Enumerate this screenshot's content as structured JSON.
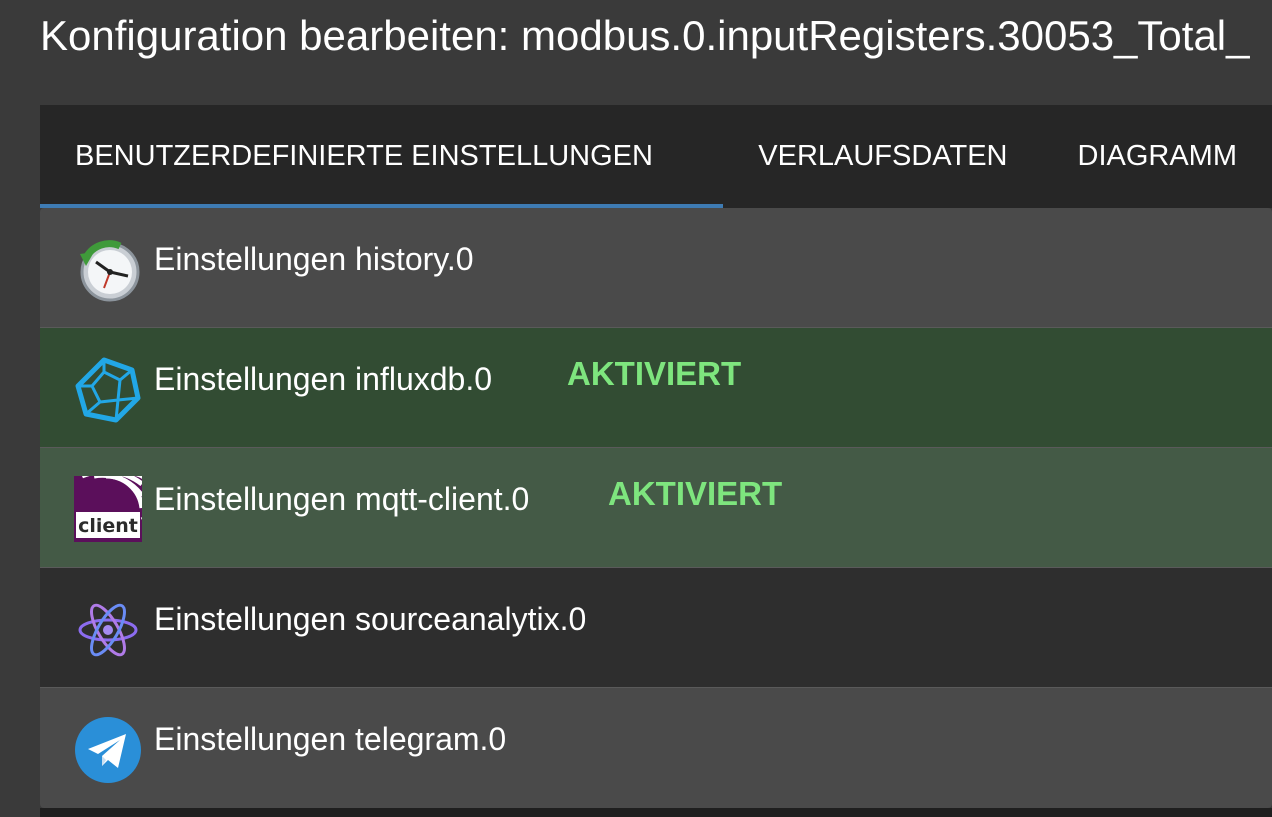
{
  "header": {
    "title": "Konfiguration bearbeiten: modbus.0.inputRegisters.30053_Total_"
  },
  "tabs": [
    {
      "label": "BENUTZERDEFINIERTE EINSTELLUNGEN",
      "active": true
    },
    {
      "label": "VERLAUFSDATEN",
      "active": false
    },
    {
      "label": "DIAGRAMM",
      "active": false
    }
  ],
  "colors": {
    "background": "#3a3a3a",
    "tabbar": "#262626",
    "active_tab_indicator": "#3e7bb3",
    "enabled_badge": "#7ee57e",
    "row_default": "#4a4a4a",
    "row_dark": "#2e2e2e",
    "row_enabled_dark": "#324c33",
    "row_enabled_light": "#445a46"
  },
  "instances": [
    {
      "label": "Einstellungen history.0",
      "icon": "history-clock-icon",
      "badge": ""
    },
    {
      "label": "Einstellungen influxdb.0",
      "icon": "influxdb-icon",
      "badge": "AKTIVIERT"
    },
    {
      "label": "Einstellungen mqtt-client.0",
      "icon": "mqtt-client-icon",
      "badge": "AKTIVIERT"
    },
    {
      "label": "Einstellungen sourceanalytix.0",
      "icon": "sourceanalytix-atom-icon",
      "badge": ""
    },
    {
      "label": "Einstellungen telegram.0",
      "icon": "telegram-icon",
      "badge": ""
    }
  ]
}
